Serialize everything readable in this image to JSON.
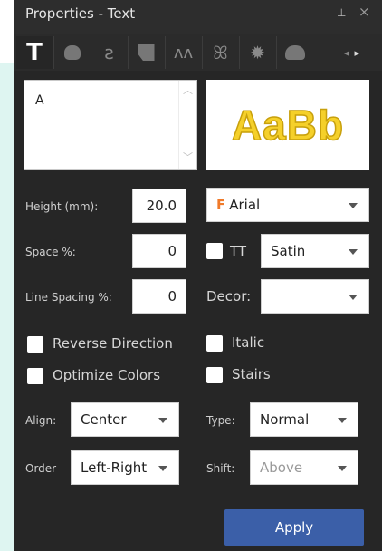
{
  "panel": {
    "title": "Properties - Text",
    "pin_icon": "pin-icon",
    "close_glyph": "×"
  },
  "tabs": [
    {
      "icon": "text-tool-icon",
      "glyph": "T",
      "active": true
    },
    {
      "icon": "fill-shape-icon",
      "active": false
    },
    {
      "icon": "stroke-s-icon",
      "glyph": "ƨ",
      "active": false
    },
    {
      "icon": "tile-icon",
      "active": false
    },
    {
      "icon": "wave-icon",
      "glyph": "᯾",
      "active": false
    },
    {
      "icon": "fringe-icon",
      "glyph": "ꕤ",
      "active": false
    },
    {
      "icon": "gear-icon",
      "glyph": "✹",
      "active": false
    },
    {
      "icon": "bump-icon",
      "active": false
    }
  ],
  "tab_scroll": {
    "left": "◂",
    "right": "▸"
  },
  "text_input": {
    "value": "A"
  },
  "preview": {
    "sample": "AaBb"
  },
  "height": {
    "label": "Height (mm):",
    "value": "20.0"
  },
  "space": {
    "label": "Space %:",
    "value": "0"
  },
  "line_spacing": {
    "label": "Line Spacing %:",
    "value": "0"
  },
  "font": {
    "icon": "F",
    "value": "Arial"
  },
  "tt": {
    "label": "TT",
    "checked": false
  },
  "stitch": {
    "value": "Satin"
  },
  "decor": {
    "label": "Decor:",
    "value": ""
  },
  "checks": {
    "reverse_direction": "Reverse Direction",
    "optimize_colors": "Optimize Colors",
    "italic": "Italic",
    "stairs": "Stairs"
  },
  "align": {
    "label": "Align:",
    "value": "Center"
  },
  "order": {
    "label": "Order",
    "value": "Left-Right"
  },
  "type": {
    "label": "Type:",
    "value": "Normal"
  },
  "shift": {
    "label": "Shift:",
    "value": "Above"
  },
  "apply_label": "Apply",
  "colors": {
    "panel_bg": "#262626",
    "accent": "#3b5fa8",
    "preview_fill": "#f5d02a"
  }
}
